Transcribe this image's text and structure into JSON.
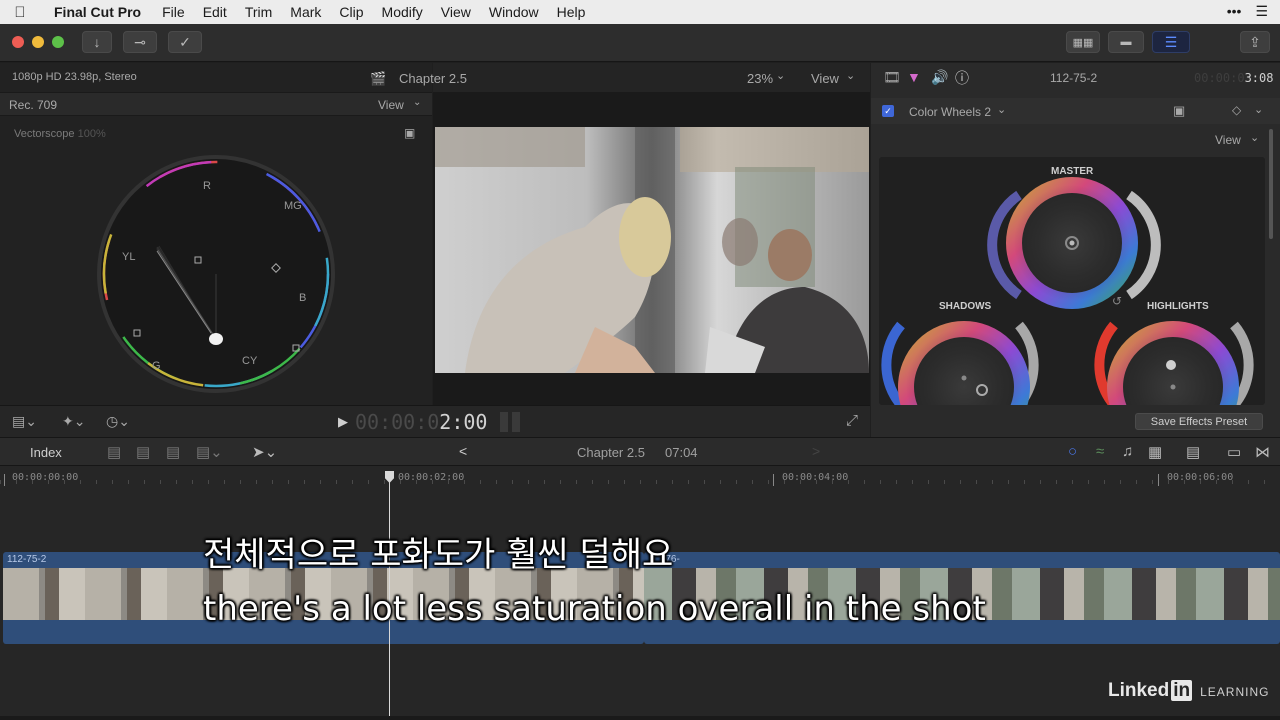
{
  "menubar": {
    "app_name": "Final Cut Pro",
    "items": [
      "File",
      "Edit",
      "Trim",
      "Mark",
      "Clip",
      "Modify",
      "View",
      "Window",
      "Help"
    ]
  },
  "browser": {
    "format": "1080p HD 23.98p, Stereo",
    "colorspace": "Rec. 709",
    "view_label": "View",
    "scope_name": "Vectorscope",
    "scope_pct": "100%",
    "scope_targets": [
      "R",
      "MG",
      "B",
      "CY",
      "G",
      "YL"
    ]
  },
  "viewer": {
    "title": "Chapter 2.5",
    "zoom": "23%",
    "view_label": "View",
    "timecode_dim": "00:00:0",
    "timecode_lit": "2:00"
  },
  "inspector": {
    "clip_name": "112-75-2",
    "duration_dim": "00:00:0",
    "duration_lit": "3:08",
    "effect_name": "Color Wheels 2",
    "view_label": "View",
    "wheels": [
      "MASTER",
      "SHADOWS",
      "HIGHLIGHTS"
    ],
    "save_preset": "Save Effects Preset"
  },
  "timeline": {
    "index_label": "Index",
    "project_name": "Chapter 2.5",
    "project_duration": "07:04",
    "ruler": [
      "00:00:00:00",
      "00:00:02:00",
      "00:00:04:00",
      "00:00:06:00"
    ],
    "clip1_name": "112-75-2",
    "clip2_name": "-76-"
  },
  "subtitles": {
    "korean": "전체적으로 포화도가 훨씬 덜해요",
    "english": "there's a lot less saturation overall in the shot"
  },
  "watermark": {
    "brand_main": "Linked",
    "brand_in": "in",
    "brand_sub": "LEARNING"
  },
  "colors": {
    "accent_blue": "#3f67d8",
    "clip_blue": "#2f4e7a",
    "playhead": "#d9d9d9"
  }
}
